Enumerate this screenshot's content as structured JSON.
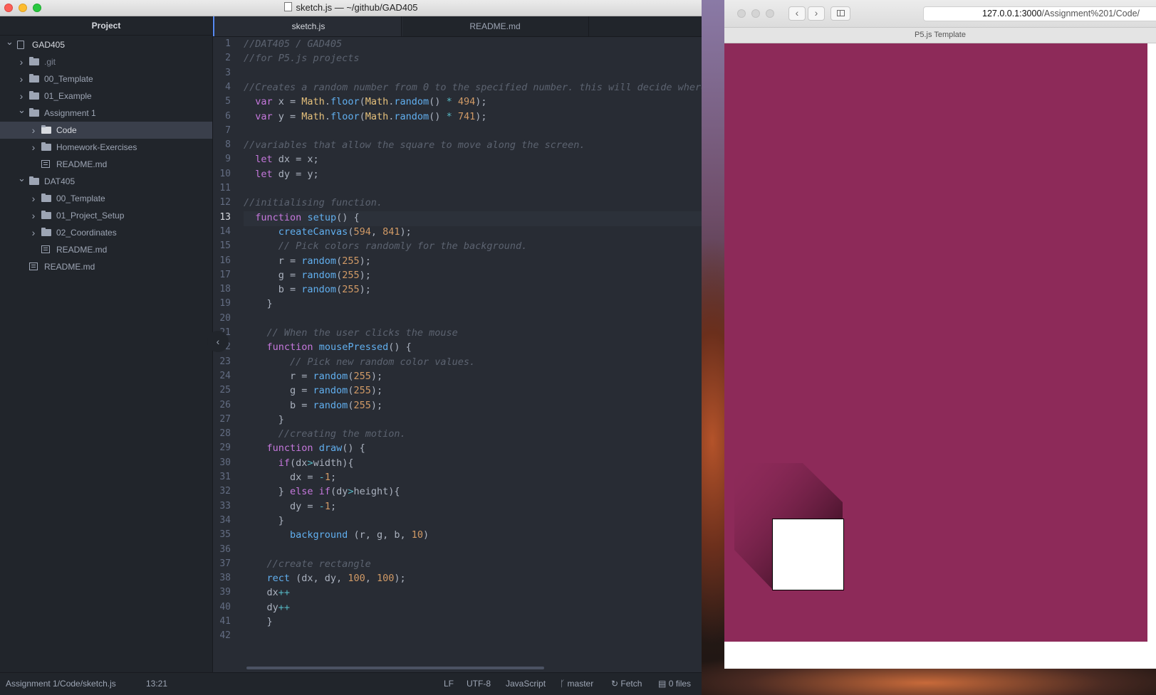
{
  "editor": {
    "window_title": "sketch.js — ~/github/GAD405",
    "tree": {
      "header": "Project",
      "items": [
        {
          "label": "GAD405",
          "kind": "repo",
          "depth": 0,
          "expanded": true
        },
        {
          "label": ".git",
          "kind": "folder",
          "depth": 1,
          "expanded": false,
          "dim": true
        },
        {
          "label": "00_Template",
          "kind": "folder",
          "depth": 1,
          "expanded": false
        },
        {
          "label": "01_Example",
          "kind": "folder",
          "depth": 1,
          "expanded": false
        },
        {
          "label": "Assignment 1",
          "kind": "folder",
          "depth": 1,
          "expanded": true
        },
        {
          "label": "Code",
          "kind": "folder",
          "depth": 2,
          "expanded": false,
          "selected": true
        },
        {
          "label": "Homework-Exercises",
          "kind": "folder",
          "depth": 2,
          "expanded": false
        },
        {
          "label": "README.md",
          "kind": "file",
          "depth": 2
        },
        {
          "label": "DAT405",
          "kind": "folder",
          "depth": 1,
          "expanded": true
        },
        {
          "label": "00_Template",
          "kind": "folder",
          "depth": 2,
          "expanded": false
        },
        {
          "label": "01_Project_Setup",
          "kind": "folder",
          "depth": 2,
          "expanded": false
        },
        {
          "label": "02_Coordinates",
          "kind": "folder",
          "depth": 2,
          "expanded": false
        },
        {
          "label": "README.md",
          "kind": "file",
          "depth": 2
        },
        {
          "label": "README.md",
          "kind": "file",
          "depth": 1
        }
      ]
    },
    "tabs": [
      {
        "label": "sketch.js",
        "active": true
      },
      {
        "label": "README.md",
        "active": false
      }
    ],
    "cursor_line": 13,
    "code_lines": [
      [
        [
          "c",
          "//DAT405 / GAD405"
        ]
      ],
      [
        [
          "c",
          "//for P5.js projects"
        ]
      ],
      [],
      [
        [
          "c",
          "//Creates a random number from 0 to the specified number. this will decide where the square starts"
        ]
      ],
      [
        [
          "t",
          "  "
        ],
        [
          "k",
          "var"
        ],
        [
          "t",
          " x = "
        ],
        [
          "y",
          "Math"
        ],
        [
          "t",
          "."
        ],
        [
          "f",
          "floor"
        ],
        [
          "t",
          "("
        ],
        [
          "y",
          "Math"
        ],
        [
          "t",
          "."
        ],
        [
          "f",
          "random"
        ],
        [
          "t",
          "() "
        ],
        [
          "o",
          "*"
        ],
        [
          "t",
          " "
        ],
        [
          "n",
          "494"
        ],
        [
          "t",
          ");"
        ]
      ],
      [
        [
          "t",
          "  "
        ],
        [
          "k",
          "var"
        ],
        [
          "t",
          " y = "
        ],
        [
          "y",
          "Math"
        ],
        [
          "t",
          "."
        ],
        [
          "f",
          "floor"
        ],
        [
          "t",
          "("
        ],
        [
          "y",
          "Math"
        ],
        [
          "t",
          "."
        ],
        [
          "f",
          "random"
        ],
        [
          "t",
          "() "
        ],
        [
          "o",
          "*"
        ],
        [
          "t",
          " "
        ],
        [
          "n",
          "741"
        ],
        [
          "t",
          ");"
        ]
      ],
      [],
      [
        [
          "c",
          "//variables that allow the square to move along the screen."
        ]
      ],
      [
        [
          "t",
          "  "
        ],
        [
          "k",
          "let"
        ],
        [
          "t",
          " dx = x;"
        ]
      ],
      [
        [
          "t",
          "  "
        ],
        [
          "k",
          "let"
        ],
        [
          "t",
          " dy = y;"
        ]
      ],
      [],
      [
        [
          "c",
          "//initialising function."
        ]
      ],
      [
        [
          "t",
          "  "
        ],
        [
          "k",
          "function"
        ],
        [
          "t",
          " "
        ],
        [
          "f",
          "setup"
        ],
        [
          "t",
          "() {"
        ]
      ],
      [
        [
          "t",
          "      "
        ],
        [
          "f",
          "createCanvas"
        ],
        [
          "t",
          "("
        ],
        [
          "n",
          "594"
        ],
        [
          "t",
          ", "
        ],
        [
          "n",
          "841"
        ],
        [
          "t",
          ");"
        ]
      ],
      [
        [
          "t",
          "      "
        ],
        [
          "c",
          "// Pick colors randomly for the background."
        ]
      ],
      [
        [
          "t",
          "      r = "
        ],
        [
          "f",
          "random"
        ],
        [
          "t",
          "("
        ],
        [
          "n",
          "255"
        ],
        [
          "t",
          ");"
        ]
      ],
      [
        [
          "t",
          "      g = "
        ],
        [
          "f",
          "random"
        ],
        [
          "t",
          "("
        ],
        [
          "n",
          "255"
        ],
        [
          "t",
          ");"
        ]
      ],
      [
        [
          "t",
          "      b = "
        ],
        [
          "f",
          "random"
        ],
        [
          "t",
          "("
        ],
        [
          "n",
          "255"
        ],
        [
          "t",
          ");"
        ]
      ],
      [
        [
          "t",
          "    }"
        ]
      ],
      [],
      [
        [
          "t",
          "    "
        ],
        [
          "c",
          "// When the user clicks the mouse"
        ]
      ],
      [
        [
          "t",
          "    "
        ],
        [
          "k",
          "function"
        ],
        [
          "t",
          " "
        ],
        [
          "f",
          "mousePressed"
        ],
        [
          "t",
          "() {"
        ]
      ],
      [
        [
          "t",
          "        "
        ],
        [
          "c",
          "// Pick new random color values."
        ]
      ],
      [
        [
          "t",
          "        r = "
        ],
        [
          "f",
          "random"
        ],
        [
          "t",
          "("
        ],
        [
          "n",
          "255"
        ],
        [
          "t",
          ");"
        ]
      ],
      [
        [
          "t",
          "        g = "
        ],
        [
          "f",
          "random"
        ],
        [
          "t",
          "("
        ],
        [
          "n",
          "255"
        ],
        [
          "t",
          ");"
        ]
      ],
      [
        [
          "t",
          "        b = "
        ],
        [
          "f",
          "random"
        ],
        [
          "t",
          "("
        ],
        [
          "n",
          "255"
        ],
        [
          "t",
          ");"
        ]
      ],
      [
        [
          "t",
          "      }"
        ]
      ],
      [
        [
          "t",
          "      "
        ],
        [
          "c",
          "//creating the motion."
        ]
      ],
      [
        [
          "t",
          "    "
        ],
        [
          "k",
          "function"
        ],
        [
          "t",
          " "
        ],
        [
          "f",
          "draw"
        ],
        [
          "t",
          "() {"
        ]
      ],
      [
        [
          "t",
          "      "
        ],
        [
          "k",
          "if"
        ],
        [
          "t",
          "(dx"
        ],
        [
          "o",
          ">"
        ],
        [
          "t",
          "width){"
        ]
      ],
      [
        [
          "t",
          "        dx = "
        ],
        [
          "o",
          "-"
        ],
        [
          "n",
          "1"
        ],
        [
          "t",
          ";"
        ]
      ],
      [
        [
          "t",
          "      } "
        ],
        [
          "k",
          "else if"
        ],
        [
          "t",
          "(dy"
        ],
        [
          "o",
          ">"
        ],
        [
          "t",
          "height){"
        ]
      ],
      [
        [
          "t",
          "        dy = "
        ],
        [
          "o",
          "-"
        ],
        [
          "n",
          "1"
        ],
        [
          "t",
          ";"
        ]
      ],
      [
        [
          "t",
          "      }"
        ]
      ],
      [
        [
          "t",
          "        "
        ],
        [
          "f",
          "background"
        ],
        [
          "t",
          " (r, g, b, "
        ],
        [
          "n",
          "10"
        ],
        [
          "t",
          ")"
        ]
      ],
      [],
      [
        [
          "t",
          "    "
        ],
        [
          "c",
          "//create rectangle"
        ]
      ],
      [
        [
          "t",
          "    "
        ],
        [
          "f",
          "rect"
        ],
        [
          "t",
          " (dx, dy, "
        ],
        [
          "n",
          "100"
        ],
        [
          "t",
          ", "
        ],
        [
          "n",
          "100"
        ],
        [
          "t",
          ");"
        ]
      ],
      [
        [
          "t",
          "    dx"
        ],
        [
          "o",
          "++"
        ]
      ],
      [
        [
          "t",
          "    dy"
        ],
        [
          "o",
          "++"
        ]
      ],
      [
        [
          "t",
          "    }"
        ]
      ],
      []
    ],
    "status": {
      "path": "Assignment 1/Code/sketch.js",
      "cursor": "13:21",
      "line_ending": "LF",
      "encoding": "UTF-8",
      "grammar": "JavaScript",
      "branch": "master",
      "fetch": "Fetch",
      "files": "0 files"
    }
  },
  "browser": {
    "url_host": "127.0.0.1:3000",
    "url_path": "/Assignment%201/Code/",
    "tab_title": "P5.js Template",
    "canvas_color": "#8d2a59",
    "square_color": "#ffffff"
  },
  "colors": {
    "comment": "#5c6370",
    "keyword": "#c678dd",
    "function": "#61afef",
    "number": "#d19a66",
    "builtin": "#e5c07b",
    "operator": "#56b6c2",
    "text": "#abb2bf"
  },
  "icons": [
    "close-icon",
    "minimize-icon",
    "zoom-icon",
    "repo-icon",
    "folder-icon",
    "file-icon",
    "chevron-right-icon",
    "chevron-down-icon",
    "collapse-left-icon",
    "branch-icon",
    "sync-icon",
    "files-icon",
    "back-icon",
    "forward-icon",
    "sidebar-icon"
  ]
}
